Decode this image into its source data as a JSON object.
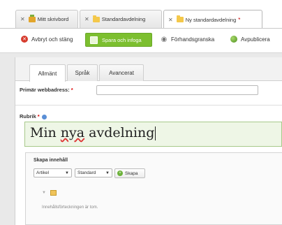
{
  "tabs": [
    {
      "label": "Mitt skrivbord",
      "icon": "desktop-icon"
    },
    {
      "label": "Standardavdelning",
      "icon": "folder-icon"
    },
    {
      "label": "Ny standardavdelning",
      "icon": "folder-icon",
      "modified_marker": "*"
    }
  ],
  "toolbar": {
    "cancel_label": "Avbryt och stäng",
    "save_label": "Spara och infoga",
    "preview_label": "Förhandsgranska",
    "unpublish_label": "Avpublicera"
  },
  "panel_tabs": [
    "Allmänt",
    "Språk",
    "Avancerat"
  ],
  "form": {
    "primary_url_label": "Primär webbadress:",
    "required_marker": "*",
    "primary_url_value": "",
    "title_label": "Rubrik",
    "title_value_prefix": "Min ",
    "title_value_misspelled": "nya",
    "title_value_suffix": " avdelning"
  },
  "create_content": {
    "heading": "Skapa innehåll",
    "type_select": "Artikel",
    "template_select": "Standard",
    "create_button": "Skapa",
    "empty_message": "Innehållsförteckningen är tom."
  },
  "colors": {
    "accent_green": "#7cbf2f",
    "cancel_red": "#d63b2d",
    "title_field_bg": "#eef6e6"
  }
}
